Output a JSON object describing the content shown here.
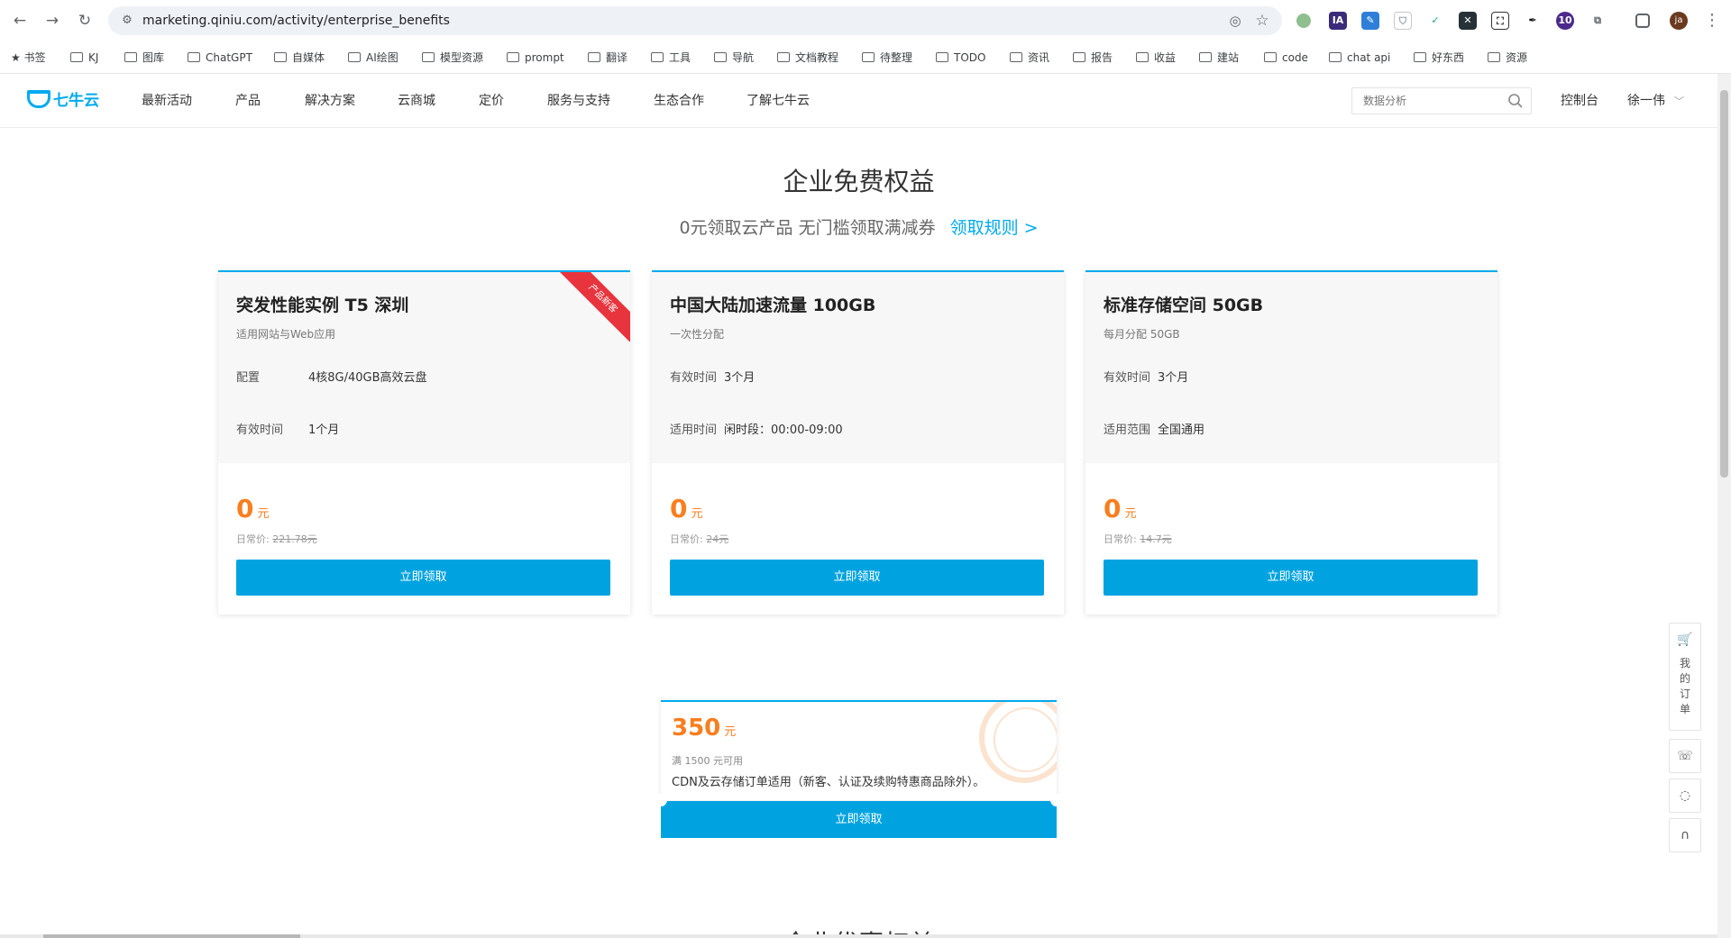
{
  "browser": {
    "url": "marketing.qiniu.com/activity/enterprise_benefits",
    "profile_initial": "ja",
    "ext_badge": "10"
  },
  "bookmarks": {
    "bookmarks_label": "书签",
    "items": [
      "KJ",
      "图库",
      "ChatGPT",
      "自媒体",
      "AI绘图",
      "模型资源",
      "prompt",
      "翻译",
      "工具",
      "导航",
      "文档教程",
      "待整理",
      "TODO",
      "资讯",
      "报告",
      "收益",
      "建站",
      "code",
      "chat api",
      "好东西",
      "资源"
    ]
  },
  "header": {
    "logo_text": "七牛云",
    "nav": [
      "最新活动",
      "产品",
      "解决方案",
      "云商城",
      "定价",
      "服务与支持",
      "生态合作",
      "了解七牛云"
    ],
    "search_placeholder": "数据分析",
    "console": "控制台",
    "user_name": "徐一伟"
  },
  "main": {
    "title": "企业免费权益",
    "subtitle": "0元领取云产品 无门槛领取满减券",
    "rule_link": "领取规则 >",
    "cards": [
      {
        "title": "突发性能实例 T5 深圳",
        "desc": "适用网站与Web应用",
        "ribbon": "产品新客",
        "rows": [
          {
            "label": "配置",
            "value": "4核8G/40GB高效云盘"
          },
          {
            "label": "有效时间",
            "value": "1个月"
          }
        ],
        "price": "0",
        "unit": "元",
        "orig_label": "日常价:",
        "orig_price": "221.78元",
        "button": "立即领取"
      },
      {
        "title": "中国大陆加速流量 100GB",
        "desc": "一次性分配",
        "rows": [
          {
            "label": "有效时间",
            "value": "3个月"
          },
          {
            "label": "适用时间",
            "value": "闲时段：00:00-09:00"
          }
        ],
        "price": "0",
        "unit": "元",
        "orig_label": "日常价:",
        "orig_price": "24元",
        "button": "立即领取"
      },
      {
        "title": "标准存储空间 50GB",
        "desc": "每月分配 50GB",
        "rows": [
          {
            "label": "有效时间",
            "value": "3个月"
          },
          {
            "label": "适用范围",
            "value": "全国通用"
          }
        ],
        "price": "0",
        "unit": "元",
        "orig_label": "日常价:",
        "orig_price": "14.7元",
        "button": "立即领取"
      }
    ],
    "coupon": {
      "amount": "350",
      "unit": "元",
      "condition": "满 1500 元可用",
      "scope": "CDN及云存储订单适用（新客、认证及续购特惠商品除外）。",
      "button": "立即领取"
    },
    "next_section_title": "企业优惠权益"
  },
  "side_toolbar": {
    "orders_label": "我的订单"
  }
}
